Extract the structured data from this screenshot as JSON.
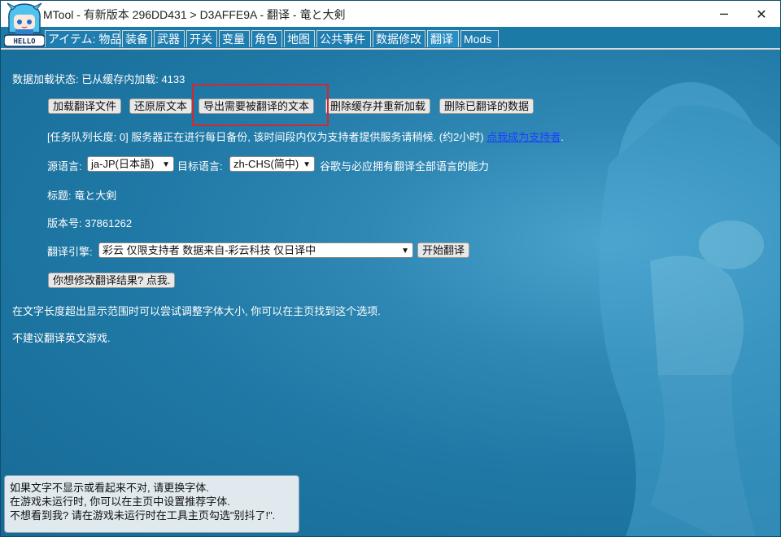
{
  "window": {
    "title": "MTool - 有新版本 296DD431 > D3AFFE9A - 翻译 - 竜と大剣",
    "logo_text": "HELLO",
    "minimize_label": "─",
    "close_label": "✕"
  },
  "tabs": [
    {
      "label": "アイテム: 物品"
    },
    {
      "label": "装备"
    },
    {
      "label": "武器"
    },
    {
      "label": "开关"
    },
    {
      "label": "变量"
    },
    {
      "label": "角色"
    },
    {
      "label": "地图"
    },
    {
      "label": "公共事件"
    },
    {
      "label": "数据修改"
    },
    {
      "label": "翻译",
      "active": true
    },
    {
      "label": "Mods"
    }
  ],
  "content": {
    "load_status": "数据加载状态: 已从缓存内加载: 4133",
    "buttons": {
      "load_translation_file": "加载翻译文件",
      "restore_original": "还原原文本",
      "export_texts": "导出需要被翻译的文本",
      "clear_cache_reload": "删除缓存并重新加载",
      "delete_translated": "删除已翻译的数据",
      "start_translate": "开始翻译",
      "modify_results": "你想修改翻译结果? 点我."
    },
    "queue_notice": "[任务队列长度: 0] 服务器正在进行每日备份, 该时间段内仅为支持者提供服务请稍候. (约2小时)",
    "supporter_link": "点我成为支持者",
    "supporter_link_suffix": ".",
    "source_lang_label": "源语言:",
    "source_lang_value": "ja-JP(日本語)",
    "target_lang_label": "目标语言:",
    "target_lang_value": "zh-CHS(简中)",
    "lang_note": "谷歌与必应拥有翻译全部语言的能力",
    "title_line": "标题: 竜と大剣",
    "version_line": "版本号: 37861262",
    "engine_label": "翻译引擎:",
    "engine_value": "彩云 仅限支持者 数据来自-彩云科技 仅日译中",
    "font_hint": "在文字长度超出显示范围时可以尝试调整字体大小, 你可以在主页找到这个选项.",
    "english_note": "不建议翻译英文游戏."
  },
  "tooltip": {
    "line1": "如果文字不显示或看起来不对, 请更换字体.",
    "line2": "在游戏未运行时, 你可以在主页中设置推荐字体.",
    "line3": "不想看到我? 请在游戏未运行时在工具主页勾选\"别抖了!\"."
  },
  "colors": {
    "background": "#1f78a5",
    "tab_border": "#cfd8de",
    "highlight": "#d9262e",
    "link": "#1a3fff"
  }
}
